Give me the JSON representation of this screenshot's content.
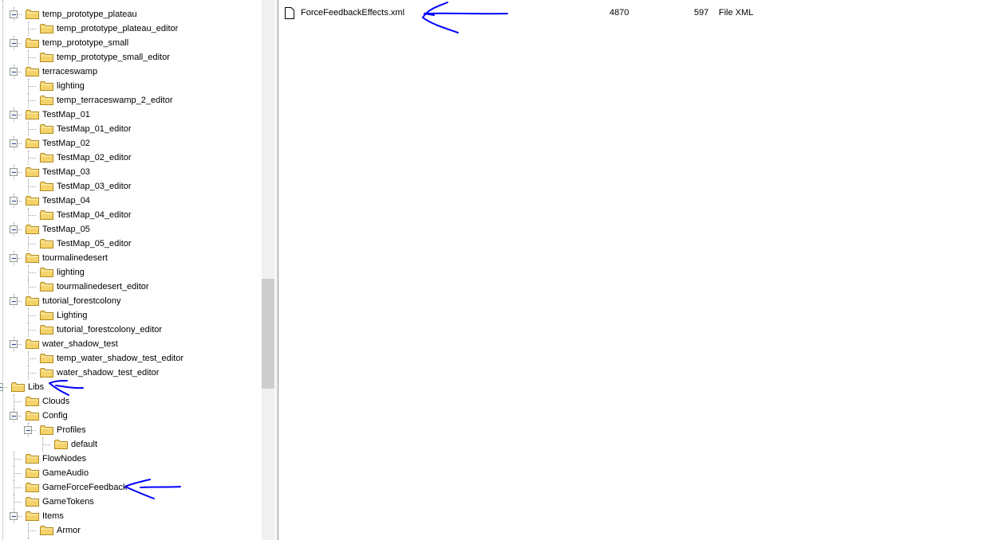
{
  "tree": {
    "items": [
      {
        "label": "temp_prototype_plateau",
        "level": 1,
        "expanded": true
      },
      {
        "label": "temp_prototype_plateau_editor",
        "level": 2
      },
      {
        "label": "temp_prototype_small",
        "level": 1,
        "expanded": true
      },
      {
        "label": "temp_prototype_small_editor",
        "level": 2
      },
      {
        "label": "terraceswamp",
        "level": 1,
        "expanded": true
      },
      {
        "label": "lighting",
        "level": 2
      },
      {
        "label": "temp_terraceswamp_2_editor",
        "level": 2
      },
      {
        "label": "TestMap_01",
        "level": 1,
        "expanded": true
      },
      {
        "label": "TestMap_01_editor",
        "level": 2
      },
      {
        "label": "TestMap_02",
        "level": 1,
        "expanded": true
      },
      {
        "label": "TestMap_02_editor",
        "level": 2
      },
      {
        "label": "TestMap_03",
        "level": 1,
        "expanded": true
      },
      {
        "label": "TestMap_03_editor",
        "level": 2
      },
      {
        "label": "TestMap_04",
        "level": 1,
        "expanded": true
      },
      {
        "label": "TestMap_04_editor",
        "level": 2
      },
      {
        "label": "TestMap_05",
        "level": 1,
        "expanded": true
      },
      {
        "label": "TestMap_05_editor",
        "level": 2
      },
      {
        "label": "tourmalinedesert",
        "level": 1,
        "expanded": true
      },
      {
        "label": "lighting",
        "level": 2
      },
      {
        "label": "tourmalinedesert_editor",
        "level": 2
      },
      {
        "label": "tutorial_forestcolony",
        "level": 1,
        "expanded": true
      },
      {
        "label": "Lighting",
        "level": 2
      },
      {
        "label": "tutorial_forestcolony_editor",
        "level": 2
      },
      {
        "label": "water_shadow_test",
        "level": 1,
        "expanded": true
      },
      {
        "label": "temp_water_shadow_test_editor",
        "level": 2
      },
      {
        "label": "water_shadow_test_editor",
        "level": 2
      },
      {
        "label": "Libs",
        "level": 0,
        "expanded": true
      },
      {
        "label": "Clouds",
        "level": 1
      },
      {
        "label": "Config",
        "level": 1,
        "expanded": true
      },
      {
        "label": "Profiles",
        "level": 2,
        "expanded": true
      },
      {
        "label": "default",
        "level": 3
      },
      {
        "label": "FlowNodes",
        "level": 1
      },
      {
        "label": "GameAudio",
        "level": 1
      },
      {
        "label": "GameForceFeedback",
        "level": 1
      },
      {
        "label": "GameTokens",
        "level": 1
      },
      {
        "label": "Items",
        "level": 1,
        "expanded": true
      },
      {
        "label": "Armor",
        "level": 2
      },
      {
        "label": "",
        "level": 2
      }
    ]
  },
  "files": [
    {
      "name": "ForceFeedbackEffects.xml",
      "col2": "4870",
      "col3": "597",
      "type": "File XML",
      "icon": "file-icon"
    }
  ],
  "colors": {
    "annotation": "#0000ff",
    "folder": "#f5d36b",
    "selection_none": "#ffffff"
  }
}
